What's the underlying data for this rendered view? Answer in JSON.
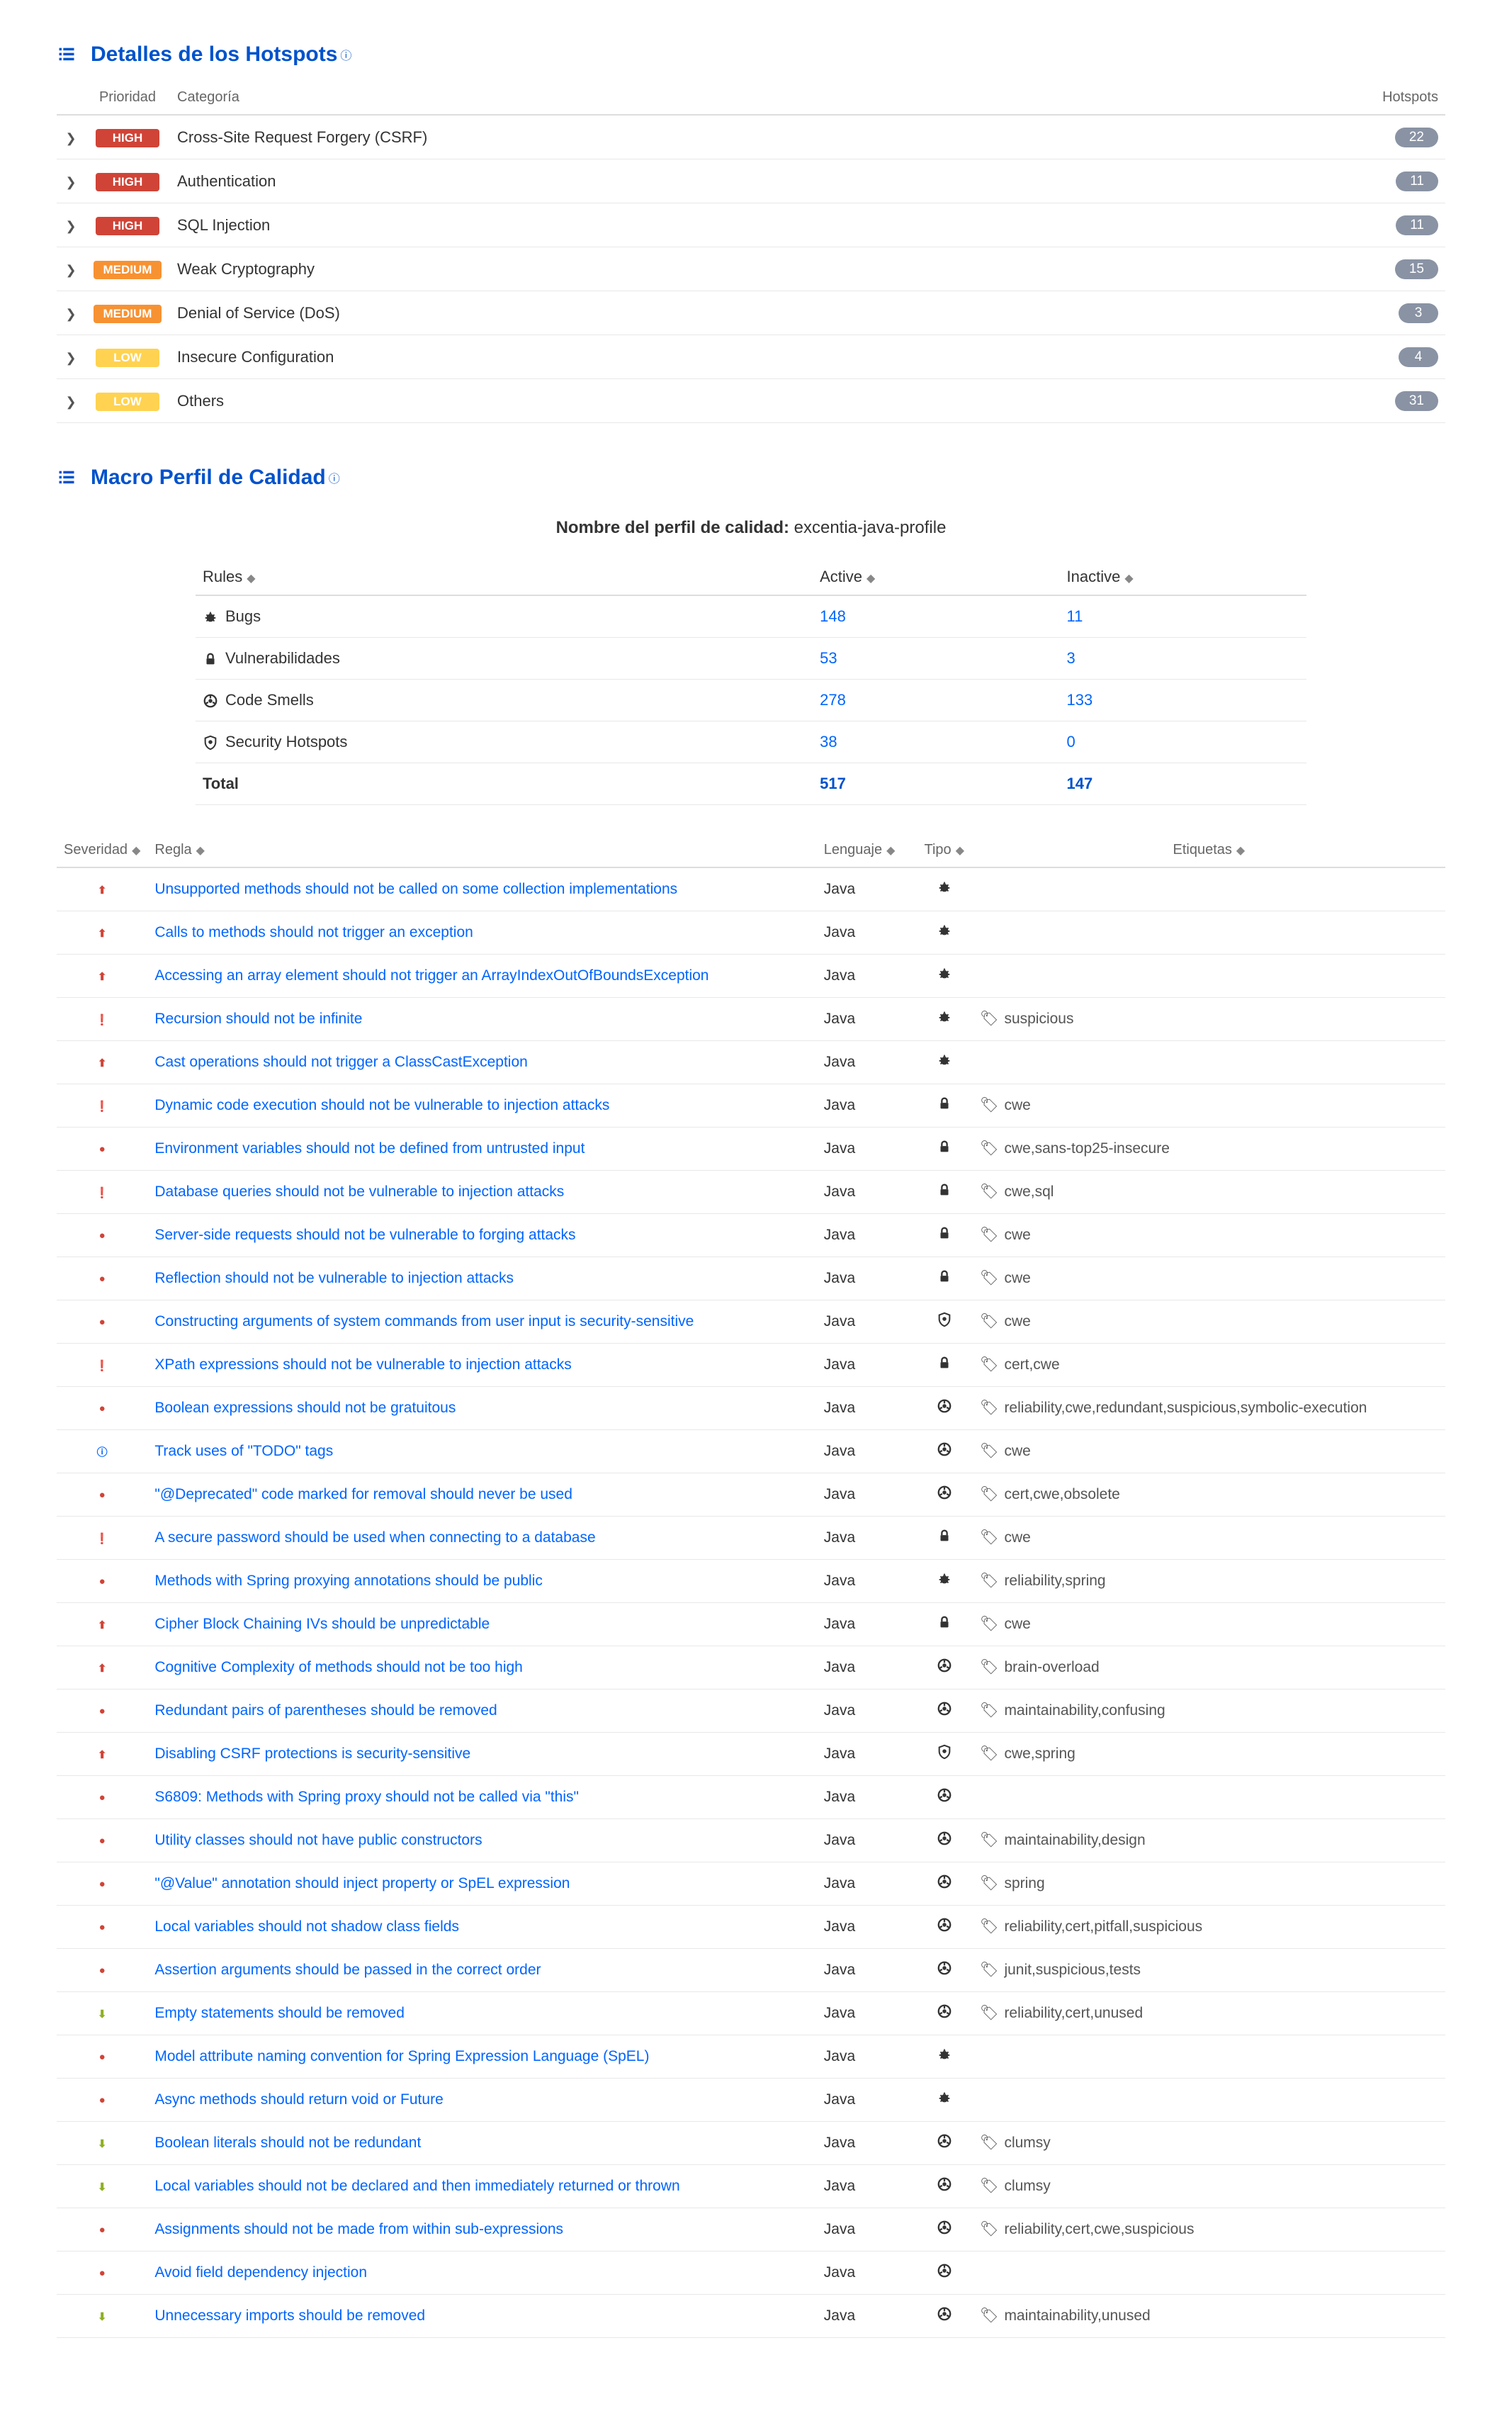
{
  "sections": {
    "hotspots_title": "Detalles de los Hotspots",
    "quality_title": "Macro Perfil de Calidad"
  },
  "hotspot_headers": {
    "priority": "Prioridad",
    "category": "Categoría",
    "hotspots": "Hotspots"
  },
  "hotspots": [
    {
      "priority": "HIGH",
      "priority_class": "prio-high",
      "category": "Cross-Site Request Forgery (CSRF)",
      "count": "22"
    },
    {
      "priority": "HIGH",
      "priority_class": "prio-high",
      "category": "Authentication",
      "count": "11"
    },
    {
      "priority": "HIGH",
      "priority_class": "prio-high",
      "category": "SQL Injection",
      "count": "11"
    },
    {
      "priority": "MEDIUM",
      "priority_class": "prio-medium",
      "category": "Weak Cryptography",
      "count": "15"
    },
    {
      "priority": "MEDIUM",
      "priority_class": "prio-medium",
      "category": "Denial of Service (DoS)",
      "count": "3"
    },
    {
      "priority": "LOW",
      "priority_class": "prio-low",
      "category": "Insecure Configuration",
      "count": "4"
    },
    {
      "priority": "LOW",
      "priority_class": "prio-low",
      "category": "Others",
      "count": "31"
    }
  ],
  "profile": {
    "label": "Nombre del perfil de calidad:",
    "name": "excentia-java-profile"
  },
  "rules_headers": {
    "rules": "Rules",
    "active": "Active",
    "inactive": "Inactive"
  },
  "rules_rows": [
    {
      "icon": "bug",
      "label": "Bugs",
      "active": "148",
      "inactive": "11"
    },
    {
      "icon": "lock",
      "label": "Vulnerabilidades",
      "active": "53",
      "inactive": "3"
    },
    {
      "icon": "smell",
      "label": "Code Smells",
      "active": "278",
      "inactive": "133"
    },
    {
      "icon": "shield",
      "label": "Security Hotspots",
      "active": "38",
      "inactive": "0"
    }
  ],
  "rules_total": {
    "label": "Total",
    "active": "517",
    "inactive": "147"
  },
  "detail_headers": {
    "severity": "Severidad",
    "rule": "Regla",
    "language": "Lenguaje",
    "type": "Tipo",
    "tags": "Etiquetas"
  },
  "detail_rows": [
    {
      "sev": "critical",
      "rule": "Unsupported methods should not be called on some collection implementations",
      "lang": "Java",
      "type": "bug",
      "tags": ""
    },
    {
      "sev": "critical",
      "rule": "Calls to methods should not trigger an exception",
      "lang": "Java",
      "type": "bug",
      "tags": ""
    },
    {
      "sev": "critical",
      "rule": "Accessing an array element should not trigger an ArrayIndexOutOfBoundsException",
      "lang": "Java",
      "type": "bug",
      "tags": ""
    },
    {
      "sev": "blocker",
      "rule": "Recursion should not be infinite",
      "lang": "Java",
      "type": "bug",
      "tags": "suspicious"
    },
    {
      "sev": "critical",
      "rule": "Cast operations should not trigger a ClassCastException",
      "lang": "Java",
      "type": "bug",
      "tags": ""
    },
    {
      "sev": "blocker",
      "rule": "Dynamic code execution should not be vulnerable to injection attacks",
      "lang": "Java",
      "type": "vuln",
      "tags": "cwe"
    },
    {
      "sev": "major",
      "rule": "Environment variables should not be defined from untrusted input",
      "lang": "Java",
      "type": "vuln",
      "tags": "cwe,sans-top25-insecure"
    },
    {
      "sev": "blocker",
      "rule": "Database queries should not be vulnerable to injection attacks",
      "lang": "Java",
      "type": "vuln",
      "tags": "cwe,sql"
    },
    {
      "sev": "major",
      "rule": "Server-side requests should not be vulnerable to forging attacks",
      "lang": "Java",
      "type": "vuln",
      "tags": "cwe"
    },
    {
      "sev": "major",
      "rule": "Reflection should not be vulnerable to injection attacks",
      "lang": "Java",
      "type": "vuln",
      "tags": "cwe"
    },
    {
      "sev": "major",
      "rule": "Constructing arguments of system commands from user input is security-sensitive",
      "lang": "Java",
      "type": "hotspot",
      "tags": "cwe"
    },
    {
      "sev": "blocker",
      "rule": "XPath expressions should not be vulnerable to injection attacks",
      "lang": "Java",
      "type": "vuln",
      "tags": "cert,cwe"
    },
    {
      "sev": "major",
      "rule": "Boolean expressions should not be gratuitous",
      "lang": "Java",
      "type": "smell",
      "tags": "reliability,cwe,redundant,suspicious,symbolic-execution"
    },
    {
      "sev": "info",
      "rule": "Track uses of \"TODO\" tags",
      "lang": "Java",
      "type": "smell",
      "tags": "cwe"
    },
    {
      "sev": "major",
      "rule": "\"@Deprecated\" code marked for removal should never be used",
      "lang": "Java",
      "type": "smell",
      "tags": "cert,cwe,obsolete"
    },
    {
      "sev": "blocker",
      "rule": "A secure password should be used when connecting to a database",
      "lang": "Java",
      "type": "vuln",
      "tags": "cwe"
    },
    {
      "sev": "major",
      "rule": "Methods with Spring proxying annotations should be public",
      "lang": "Java",
      "type": "bug",
      "tags": "reliability,spring"
    },
    {
      "sev": "critical",
      "rule": "Cipher Block Chaining IVs should be unpredictable",
      "lang": "Java",
      "type": "vuln",
      "tags": "cwe"
    },
    {
      "sev": "critical",
      "rule": "Cognitive Complexity of methods should not be too high",
      "lang": "Java",
      "type": "smell",
      "tags": "brain-overload"
    },
    {
      "sev": "major",
      "rule": "Redundant pairs of parentheses should be removed",
      "lang": "Java",
      "type": "smell",
      "tags": "maintainability,confusing"
    },
    {
      "sev": "critical",
      "rule": "Disabling CSRF protections is security-sensitive",
      "lang": "Java",
      "type": "hotspot",
      "tags": "cwe,spring"
    },
    {
      "sev": "major",
      "rule": "S6809: Methods with Spring proxy should not be called via \"this\"",
      "lang": "Java",
      "type": "smell",
      "tags": ""
    },
    {
      "sev": "major",
      "rule": "Utility classes should not have public constructors",
      "lang": "Java",
      "type": "smell",
      "tags": "maintainability,design"
    },
    {
      "sev": "major",
      "rule": "\"@Value\" annotation should inject property or SpEL expression",
      "lang": "Java",
      "type": "smell",
      "tags": "spring"
    },
    {
      "sev": "major",
      "rule": "Local variables should not shadow class fields",
      "lang": "Java",
      "type": "smell",
      "tags": "reliability,cert,pitfall,suspicious"
    },
    {
      "sev": "major",
      "rule": "Assertion arguments should be passed in the correct order",
      "lang": "Java",
      "type": "smell",
      "tags": "junit,suspicious,tests"
    },
    {
      "sev": "minor",
      "rule": "Empty statements should be removed",
      "lang": "Java",
      "type": "smell",
      "tags": "reliability,cert,unused"
    },
    {
      "sev": "major",
      "rule": "Model attribute naming convention for Spring Expression Language (SpEL)",
      "lang": "Java",
      "type": "bug",
      "tags": ""
    },
    {
      "sev": "major",
      "rule": "Async methods should return void or Future",
      "lang": "Java",
      "type": "bug",
      "tags": ""
    },
    {
      "sev": "minor",
      "rule": "Boolean literals should not be redundant",
      "lang": "Java",
      "type": "smell",
      "tags": "clumsy"
    },
    {
      "sev": "minor",
      "rule": "Local variables should not be declared and then immediately returned or thrown",
      "lang": "Java",
      "type": "smell",
      "tags": "clumsy"
    },
    {
      "sev": "major",
      "rule": "Assignments should not be made from within sub-expressions",
      "lang": "Java",
      "type": "smell",
      "tags": "reliability,cert,cwe,suspicious"
    },
    {
      "sev": "major",
      "rule": "Avoid field dependency injection",
      "lang": "Java",
      "type": "smell",
      "tags": ""
    },
    {
      "sev": "minor",
      "rule": "Unnecessary imports should be removed",
      "lang": "Java",
      "type": "smell",
      "tags": "maintainability,unused"
    }
  ]
}
